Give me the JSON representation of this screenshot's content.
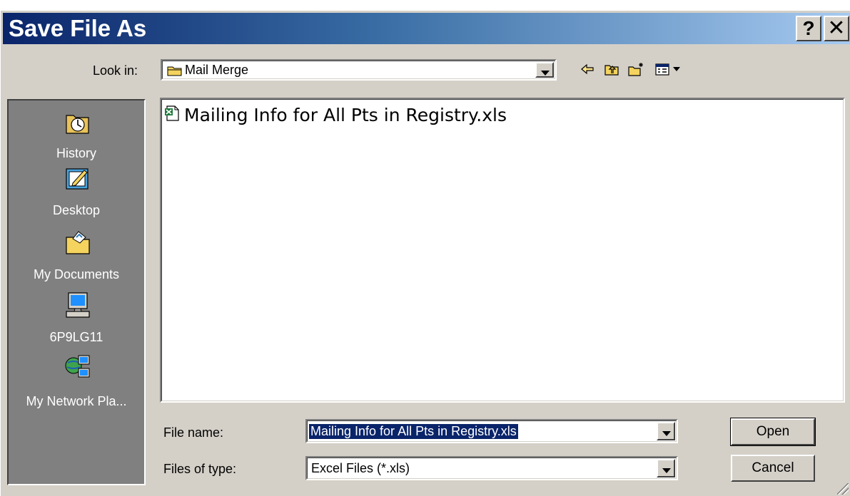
{
  "window": {
    "title": "Save File As",
    "help_glyph": "?",
    "close_glyph": "✕"
  },
  "look_in": {
    "label": "Look in:",
    "value": "Mail Merge"
  },
  "toolbar": {
    "icons": [
      "back-arrow-icon",
      "up-one-level-icon",
      "new-folder-icon",
      "view-menu-icon"
    ]
  },
  "places_bar": {
    "items": [
      {
        "label": "History",
        "icon": "history-icon"
      },
      {
        "label": "Desktop",
        "icon": "desktop-icon"
      },
      {
        "label": "My Documents",
        "icon": "my-documents-icon"
      },
      {
        "label": "6P9LG11",
        "icon": "my-computer-icon"
      },
      {
        "label": "My Network Pla...",
        "icon": "my-network-places-icon"
      }
    ]
  },
  "file_list": {
    "items": [
      {
        "name": "Mailing Info for All Pts in Registry.xls",
        "icon": "excel-file-icon"
      }
    ]
  },
  "file_name": {
    "label": "File name:",
    "value": "Mailing Info for All Pts in Registry.xls"
  },
  "file_type": {
    "label": "Files of type:",
    "value": "Excel Files (*.xls)"
  },
  "buttons": {
    "open": "Open",
    "cancel": "Cancel"
  },
  "colors": {
    "title_start": "#0a246a",
    "title_end": "#a6caf0",
    "face": "#d4d0c8",
    "places_bg": "#808080",
    "selection": "#0a246a"
  }
}
